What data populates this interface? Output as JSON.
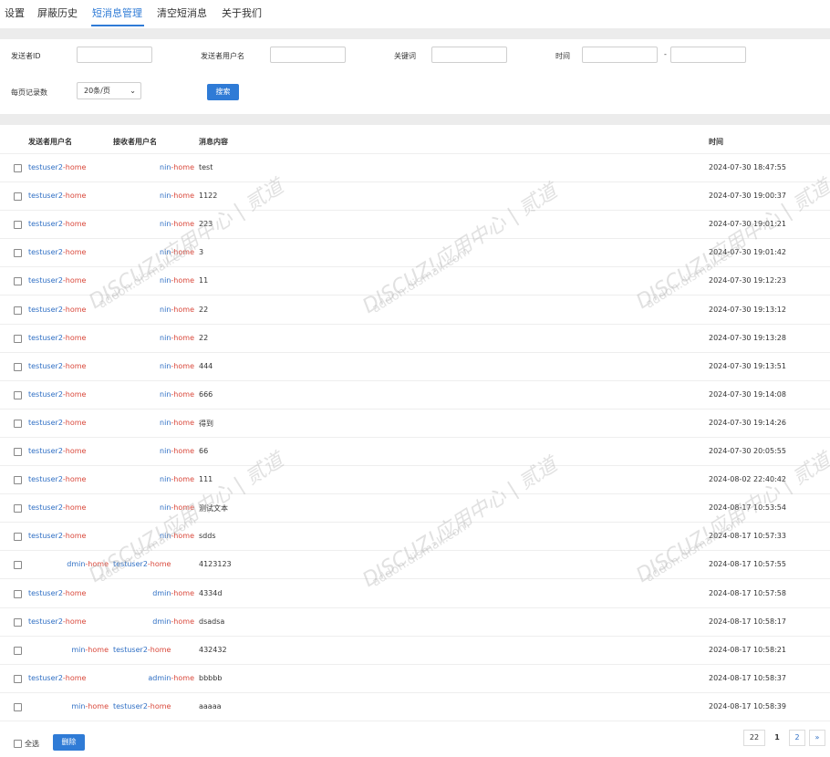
{
  "tabs": [
    "设置",
    "屏蔽历史",
    "短消息管理",
    "清空短消息",
    "关于我们"
  ],
  "search": {
    "sender_id_label": "发送者ID",
    "sender_name_label": "发送者用户名",
    "keyword_label": "关键词",
    "time_label": "时间",
    "time_sep": "-",
    "per_page_label": "每页记录数",
    "per_page_value": "20条/页",
    "search_button": "搜索"
  },
  "table": {
    "headers": [
      "发送者用户名",
      "接收者用户名",
      "消息内容",
      "时间"
    ],
    "rows": [
      {
        "sender": "testuser2-home",
        "receiver": "nin-home",
        "content": "test",
        "time": "2024-07-30 18:47:55"
      },
      {
        "sender": "testuser2-home",
        "receiver": "nin-home",
        "content": "1122",
        "time": "2024-07-30 19:00:37"
      },
      {
        "sender": "testuser2-home",
        "receiver": "nin-home",
        "content": "223",
        "time": "2024-07-30 19:01:21"
      },
      {
        "sender": "testuser2-home",
        "receiver": "nin-home",
        "content": "3",
        "time": "2024-07-30 19:01:42"
      },
      {
        "sender": "testuser2-home",
        "receiver": "nin-home",
        "content": "11",
        "time": "2024-07-30 19:12:23"
      },
      {
        "sender": "testuser2-home",
        "receiver": "nin-home",
        "content": "22",
        "time": "2024-07-30 19:13:12"
      },
      {
        "sender": "testuser2-home",
        "receiver": "nin-home",
        "content": "22",
        "time": "2024-07-30 19:13:28"
      },
      {
        "sender": "testuser2-home",
        "receiver": "nin-home",
        "content": "444",
        "time": "2024-07-30 19:13:51"
      },
      {
        "sender": "testuser2-home",
        "receiver": "nin-home",
        "content": "666",
        "time": "2024-07-30 19:14:08"
      },
      {
        "sender": "testuser2-home",
        "receiver": "nin-home",
        "content": "得到",
        "time": "2024-07-30 19:14:26"
      },
      {
        "sender": "testuser2-home",
        "receiver": "nin-home",
        "content": "66",
        "time": "2024-07-30 20:05:55"
      },
      {
        "sender": "testuser2-home",
        "receiver": "nin-home",
        "content": "111",
        "time": "2024-08-02 22:40:42"
      },
      {
        "sender": "testuser2-home",
        "receiver": "nin-home",
        "content": "测试文本",
        "time": "2024-08-17 10:53:54"
      },
      {
        "sender": "testuser2-home",
        "receiver": "nin-home",
        "content": "sdds",
        "time": "2024-08-17 10:57:33"
      },
      {
        "sender": "dmin-home",
        "receiver": "testuser2-home",
        "content": "4123123",
        "time": "2024-08-17 10:57:55"
      },
      {
        "sender": "testuser2-home",
        "receiver": "dmin-home",
        "content": "4334d",
        "time": "2024-08-17 10:57:58"
      },
      {
        "sender": "testuser2-home",
        "receiver": "dmin-home",
        "content": "dsadsa",
        "time": "2024-08-17 10:58:17"
      },
      {
        "sender": "min-home",
        "receiver": "testuser2-home",
        "content": "432432",
        "time": "2024-08-17 10:58:21"
      },
      {
        "sender": "testuser2-home",
        "receiver": "admin-home",
        "content": "bbbbb",
        "time": "2024-08-17 10:58:37"
      },
      {
        "sender": "min-home",
        "receiver": "testuser2-home",
        "content": "aaaaa",
        "time": "2024-08-17 10:58:39"
      }
    ]
  },
  "footer": {
    "select_all_label": "全选",
    "delete_button": "删除",
    "pagination": [
      "22",
      "1",
      "2",
      "»"
    ]
  },
  "watermark": {
    "line1": "DISCUZ!应用中心 | 贰道",
    "line2": "addon.dismall.com"
  }
}
